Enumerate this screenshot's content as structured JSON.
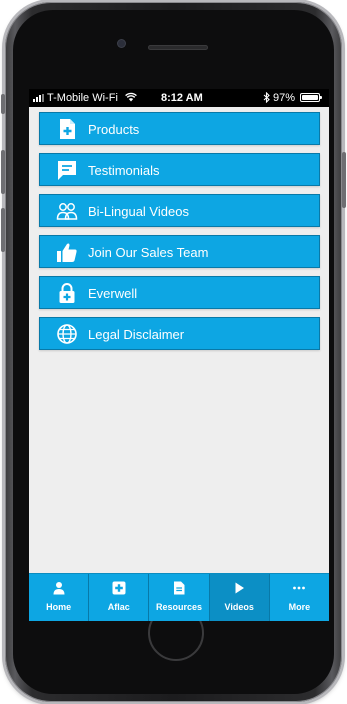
{
  "status": {
    "carrier": "T-Mobile Wi-Fi",
    "time": "8:12 AM",
    "battery": "97%",
    "battery_level": 0.97
  },
  "menu": {
    "items": [
      {
        "label": "Products",
        "icon": "document-plus-icon"
      },
      {
        "label": "Testimonials",
        "icon": "chat-bubble-icon"
      },
      {
        "label": "Bi-Lingual Videos",
        "icon": "people-icon"
      },
      {
        "label": "Join Our Sales Team",
        "icon": "thumbs-up-icon"
      },
      {
        "label": "Everwell",
        "icon": "lock-plus-icon"
      },
      {
        "label": "Legal Disclaimer",
        "icon": "globe-icon"
      }
    ]
  },
  "tabbar": {
    "tabs": [
      {
        "label": "Home",
        "icon": "person-icon"
      },
      {
        "label": "Aflac",
        "icon": "plus-square-icon"
      },
      {
        "label": "Resources",
        "icon": "document-icon"
      },
      {
        "label": "Videos",
        "icon": "play-icon",
        "active": true
      },
      {
        "label": "More",
        "icon": "ellipsis-icon"
      }
    ]
  },
  "colors": {
    "accent": "#0da6e3",
    "accent_dark": "#0879a8",
    "screen_bg": "#eeeeee"
  }
}
